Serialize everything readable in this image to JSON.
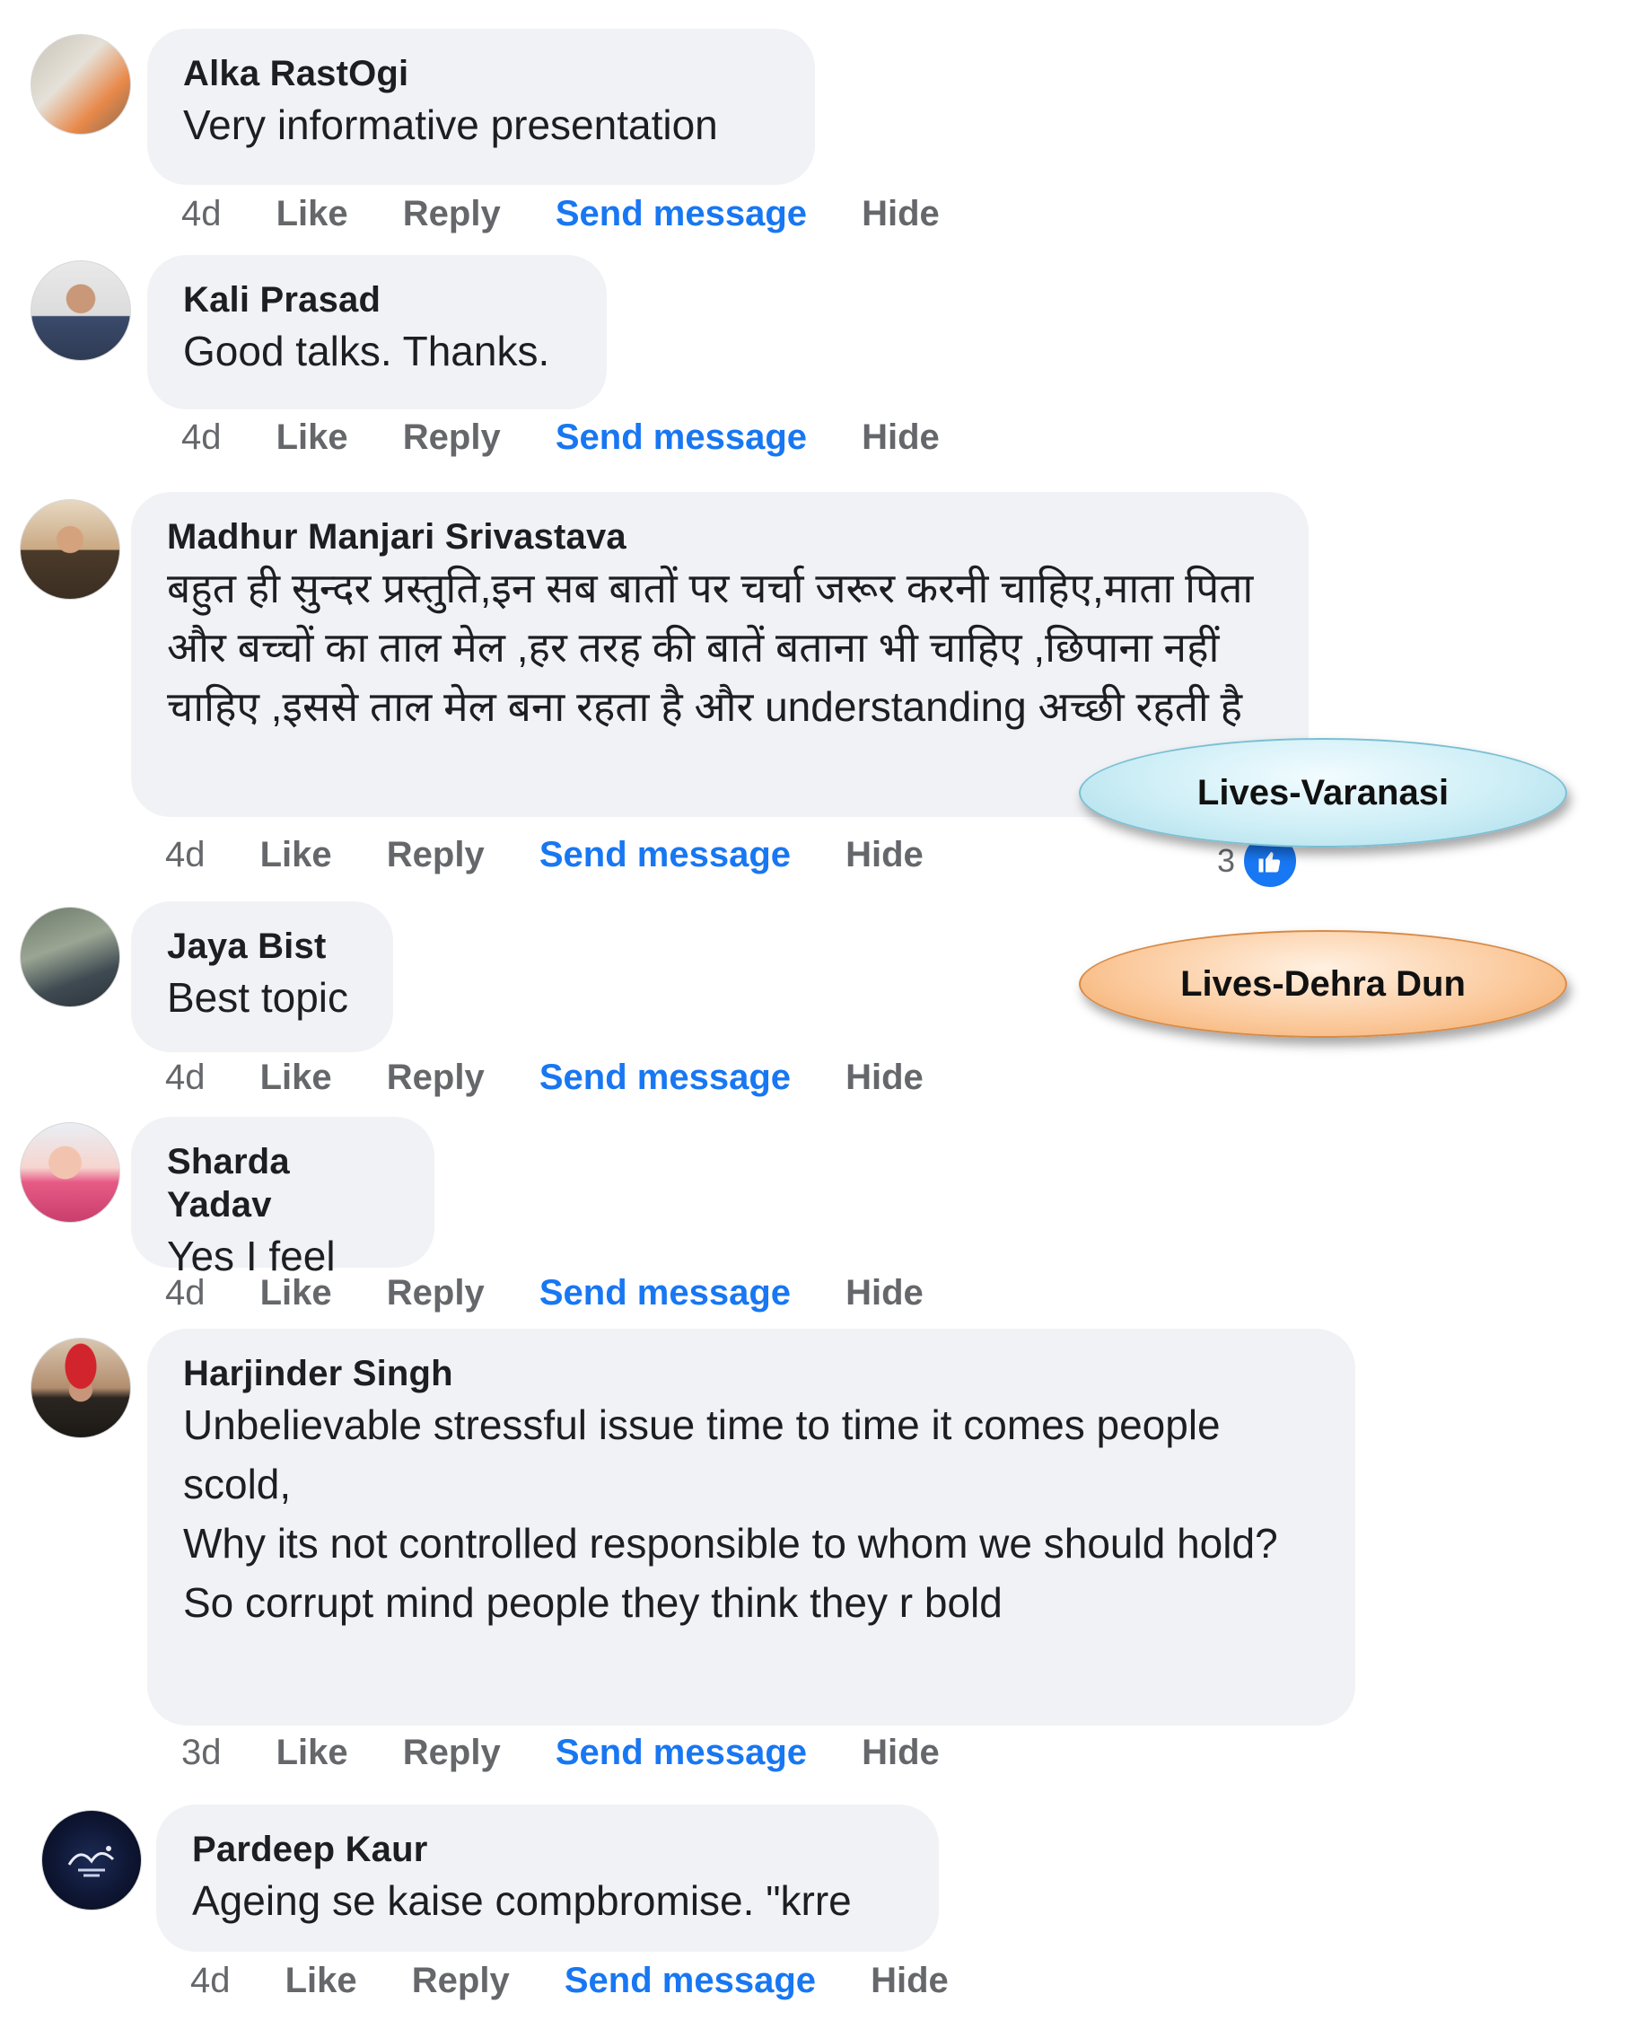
{
  "action_labels": {
    "like": "Like",
    "reply": "Reply",
    "send": "Send message",
    "hide": "Hide"
  },
  "comments": [
    {
      "author": "Alka RastOgi",
      "text": "Very informative presentation",
      "time": "4d"
    },
    {
      "author": "Kali Prasad",
      "text": "Good talks. Thanks.",
      "time": "4d"
    },
    {
      "author": "Madhur Manjari Srivastava",
      "text": "बहुत ही सुन्दर प्रस्तुति,इन सब बातों पर चर्चा जरूर करनी चाहिए,माता पिता और बच्चों का ताल मेल ,हर तरह की बातें बताना भी चाहिए ,छिपाना नहीं चाहिए ,इससे ताल मेल बना रहता है और understanding अच्छी रहती है",
      "time": "4d",
      "reaction_count": "3"
    },
    {
      "author": "Jaya Bist",
      "text": "Best topic",
      "time": "4d"
    },
    {
      "author": "Sharda Yadav",
      "text": "Yes I feel",
      "time": "4d"
    },
    {
      "author": "Harjinder Singh",
      "text": "Unbelievable stressful issue time to time it comes people scold,\nWhy its not controlled responsible to whom we should hold?\nSo corrupt mind people they think they r bold",
      "time": "3d"
    },
    {
      "author": "Pardeep Kaur",
      "text": "Ageing se kaise compbromise. \"krre",
      "time": "4d"
    }
  ],
  "callouts": [
    {
      "label": "Lives-Varanasi",
      "color": "#cdeef6"
    },
    {
      "label": "Lives-Dehra Dun",
      "color": "#fbc89a"
    }
  ],
  "colors": {
    "link": "#1877f2",
    "muted": "#65676b",
    "bubble": "#f0f2f5"
  }
}
